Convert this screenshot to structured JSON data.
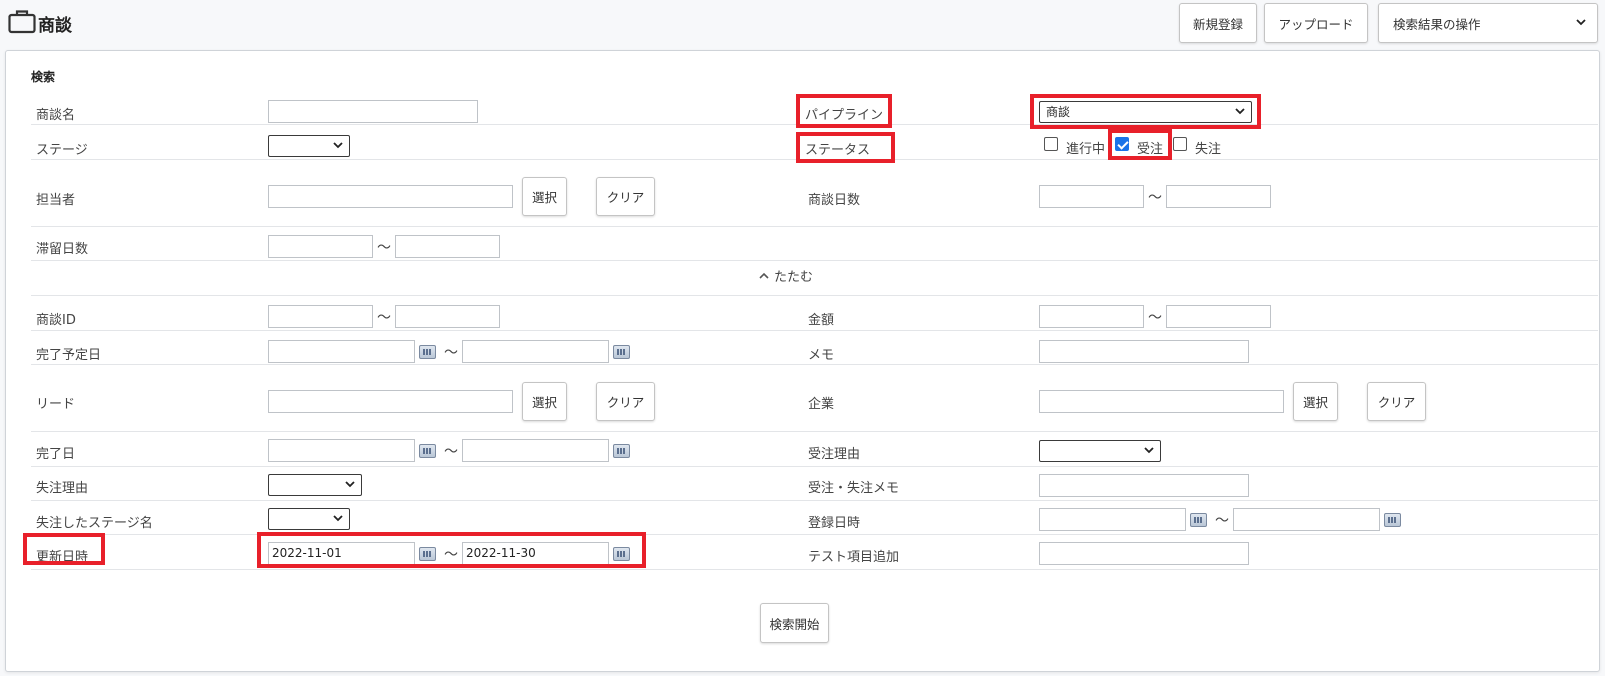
{
  "header": {
    "title": "商談",
    "new_button": "新規登録",
    "upload_button": "アップロード",
    "actions_select": "検索結果の操作"
  },
  "search": {
    "section_title": "検索",
    "collapse_label": "たたむ",
    "tilde": "～",
    "select_button": "選択",
    "clear_button": "クリア",
    "submit_button": "検索開始",
    "labels": {
      "deal_name": "商談名",
      "pipeline": "パイプライン",
      "stage": "ステージ",
      "status": "ステータス",
      "owner": "担当者",
      "deal_days": "商談日数",
      "stay_days": "滞留日数",
      "deal_id": "商談ID",
      "amount": "金額",
      "planned_date": "完了予定日",
      "memo": "メモ",
      "lead": "リード",
      "company": "企業",
      "completed_date": "完了日",
      "won_reason": "受注理由",
      "lost_reason": "失注理由",
      "won_lost_memo": "受注・失注メモ",
      "lost_stage": "失注したステージ名",
      "registered_at": "登録日時",
      "updated_at": "更新日時",
      "test_item": "テスト項目追加"
    },
    "pipeline_value": "商談",
    "status_options": [
      {
        "label": "進行中",
        "checked": false
      },
      {
        "label": "受注",
        "checked": true
      },
      {
        "label": "失注",
        "checked": false
      }
    ],
    "updated_from": "2022-11-01",
    "updated_to": "2022-11-30"
  },
  "colors": {
    "highlight": "#e8202a",
    "checkbox_checked": "#1a73e8"
  }
}
